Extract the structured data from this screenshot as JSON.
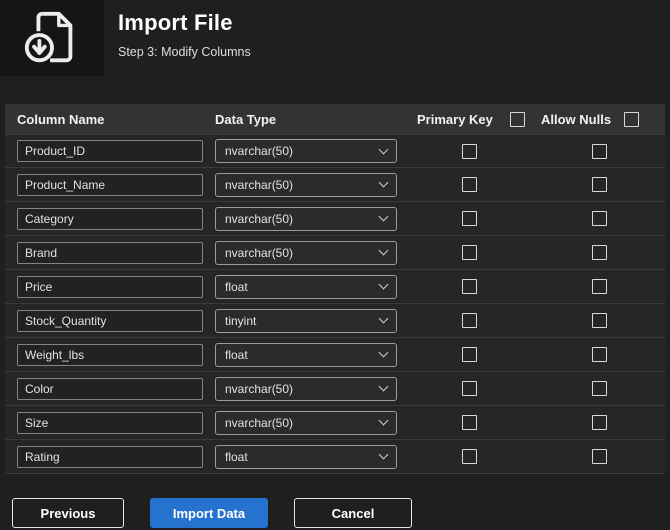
{
  "header": {
    "title": "Import File",
    "subtitle": "Step 3: Modify Columns",
    "icon": "file-import-icon"
  },
  "table": {
    "headers": {
      "column_name": "Column Name",
      "data_type": "Data Type",
      "primary_key": "Primary Key",
      "allow_nulls": "Allow Nulls"
    },
    "rows": [
      {
        "name": "Product_ID",
        "type": "nvarchar(50)",
        "primary_key": false,
        "allow_nulls": false
      },
      {
        "name": "Product_Name",
        "type": "nvarchar(50)",
        "primary_key": false,
        "allow_nulls": false
      },
      {
        "name": "Category",
        "type": "nvarchar(50)",
        "primary_key": false,
        "allow_nulls": false
      },
      {
        "name": "Brand",
        "type": "nvarchar(50)",
        "primary_key": false,
        "allow_nulls": false
      },
      {
        "name": "Price",
        "type": "float",
        "primary_key": false,
        "allow_nulls": false
      },
      {
        "name": "Stock_Quantity",
        "type": "tinyint",
        "primary_key": false,
        "allow_nulls": false
      },
      {
        "name": "Weight_lbs",
        "type": "float",
        "primary_key": false,
        "allow_nulls": false
      },
      {
        "name": "Color",
        "type": "nvarchar(50)",
        "primary_key": false,
        "allow_nulls": false
      },
      {
        "name": "Size",
        "type": "nvarchar(50)",
        "primary_key": false,
        "allow_nulls": false
      },
      {
        "name": "Rating",
        "type": "float",
        "primary_key": false,
        "allow_nulls": false
      }
    ],
    "icons": {
      "dropdown": "chevron-down-icon"
    }
  },
  "buttons": {
    "previous": "Previous",
    "import": "Import Data",
    "cancel": "Cancel"
  },
  "colors": {
    "accent": "#2673cf",
    "header_band": "#333335",
    "background": "#1f1f1f"
  }
}
